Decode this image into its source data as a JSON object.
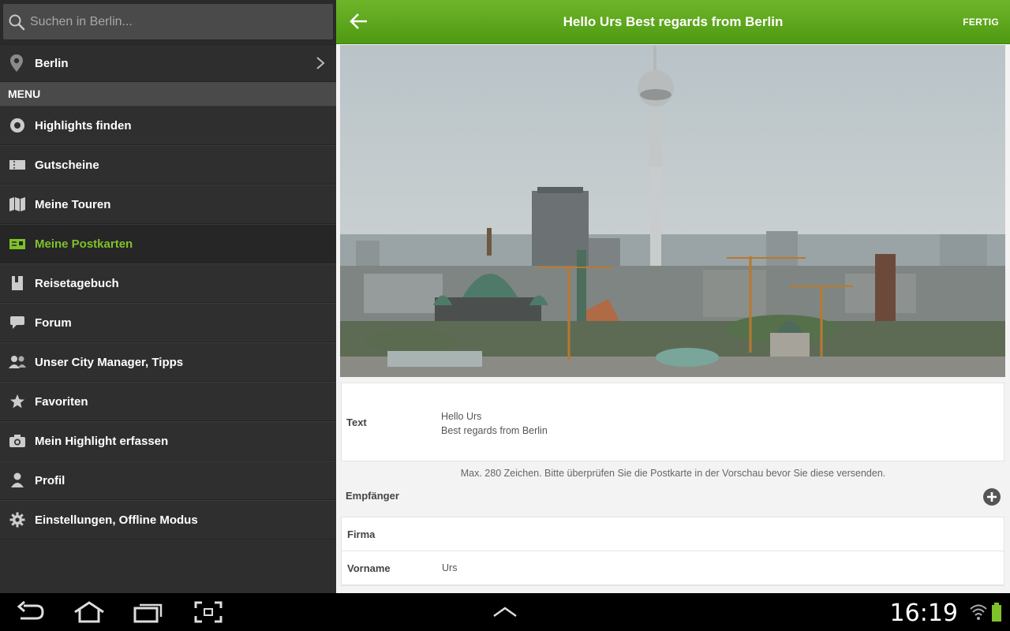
{
  "drawer": {
    "search": {
      "placeholder": "Suchen in Berlin...",
      "value": ""
    },
    "city": {
      "label": "Berlin"
    },
    "menu_header": "MENU",
    "items": [
      {
        "label": "Highlights finden",
        "icon": "target-icon",
        "active": false
      },
      {
        "label": "Gutscheine",
        "icon": "ticket-icon",
        "active": false
      },
      {
        "label": "Meine Touren",
        "icon": "map-icon",
        "active": false
      },
      {
        "label": "Meine Postkarten",
        "icon": "postcard-icon",
        "active": true
      },
      {
        "label": "Reisetagebuch",
        "icon": "diary-icon",
        "active": false
      },
      {
        "label": "Forum",
        "icon": "chat-bubble-icon",
        "active": false
      },
      {
        "label": "Unser City Manager, Tipps",
        "icon": "people-icon",
        "active": false
      },
      {
        "label": "Favoriten",
        "icon": "star-icon",
        "active": false
      },
      {
        "label": "Mein Highlight erfassen",
        "icon": "camera-icon",
        "active": false
      },
      {
        "label": "Profil",
        "icon": "person-icon",
        "active": false
      },
      {
        "label": "Einstellungen, Offline Modus",
        "icon": "gear-icon",
        "active": false
      }
    ]
  },
  "header": {
    "title": "Hello Urs Best regards from Berlin",
    "done_label": "FERTIG"
  },
  "postcard": {
    "text_label": "Text",
    "text_line1": "Hello Urs",
    "text_line2": "Best regards from Berlin",
    "hint": "Max. 280 Zeichen. Bitte überprüfen Sie die Postkarte in der Vorschau bevor Sie diese versenden.",
    "recipient_label": "Empfänger",
    "fields": [
      {
        "label": "Firma",
        "value": ""
      },
      {
        "label": "Vorname",
        "value": "Urs"
      }
    ]
  },
  "system": {
    "clock": "16:19"
  },
  "colors": {
    "accent": "#6fb52a",
    "active_text": "#7fc12a",
    "drawer_bg": "#2e2e2e"
  }
}
